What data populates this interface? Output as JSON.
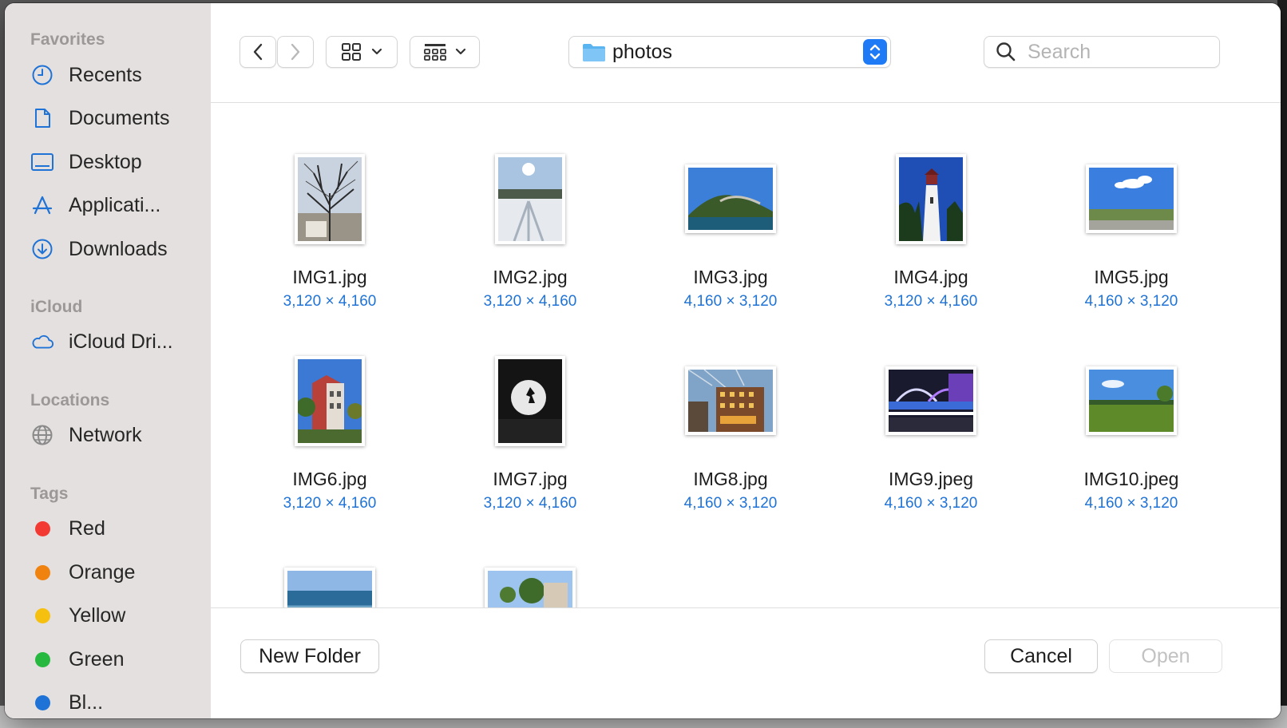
{
  "sidebar": {
    "favorites_header": "Favorites",
    "favorites": [
      {
        "label": "Recents",
        "icon": "clock-icon"
      },
      {
        "label": "Documents",
        "icon": "document-icon"
      },
      {
        "label": "Desktop",
        "icon": "desktop-icon"
      },
      {
        "label": "Applicati...",
        "icon": "applications-icon"
      },
      {
        "label": "Downloads",
        "icon": "download-icon"
      }
    ],
    "icloud_header": "iCloud",
    "icloud": [
      {
        "label": "iCloud Dri...",
        "icon": "cloud-icon"
      }
    ],
    "locations_header": "Locations",
    "locations": [
      {
        "label": "Network",
        "icon": "globe-icon"
      }
    ],
    "tags_header": "Tags",
    "tags": [
      {
        "label": "Red",
        "color": "#f23a33"
      },
      {
        "label": "Orange",
        "color": "#f0820f"
      },
      {
        "label": "Yellow",
        "color": "#f5c00f"
      },
      {
        "label": "Green",
        "color": "#27b83f"
      },
      {
        "label": "Bl...",
        "color": "#1f73d6"
      }
    ]
  },
  "toolbar": {
    "back_icon": "chevron-left-icon",
    "forward_icon": "chevron-right-icon",
    "view_icon": "icon-grid-icon",
    "group_icon": "group-grid-icon",
    "folder": "photos",
    "search_placeholder": "Search"
  },
  "files": [
    {
      "name": "IMG1.jpg",
      "dims": "3,120 × 4,160",
      "orientation": "portrait"
    },
    {
      "name": "IMG2.jpg",
      "dims": "3,120 × 4,160",
      "orientation": "portrait"
    },
    {
      "name": "IMG3.jpg",
      "dims": "4,160 × 3,120",
      "orientation": "landscape"
    },
    {
      "name": "IMG4.jpg",
      "dims": "3,120 × 4,160",
      "orientation": "portrait"
    },
    {
      "name": "IMG5.jpg",
      "dims": "4,160 × 3,120",
      "orientation": "landscape"
    },
    {
      "name": "IMG6.jpg",
      "dims": "3,120 × 4,160",
      "orientation": "portrait"
    },
    {
      "name": "IMG7.jpg",
      "dims": "3,120 × 4,160",
      "orientation": "portrait"
    },
    {
      "name": "IMG8.jpg",
      "dims": "4,160 × 3,120",
      "orientation": "landscape"
    },
    {
      "name": "IMG9.jpeg",
      "dims": "4,160 × 3,120",
      "orientation": "landscape"
    },
    {
      "name": "IMG10.jpeg",
      "dims": "4,160 × 3,120",
      "orientation": "landscape"
    }
  ],
  "footer": {
    "new_folder": "New Folder",
    "cancel": "Cancel",
    "open": "Open"
  },
  "colors": {
    "accent": "#1f7af5",
    "dims_text": "#1f73d6"
  }
}
